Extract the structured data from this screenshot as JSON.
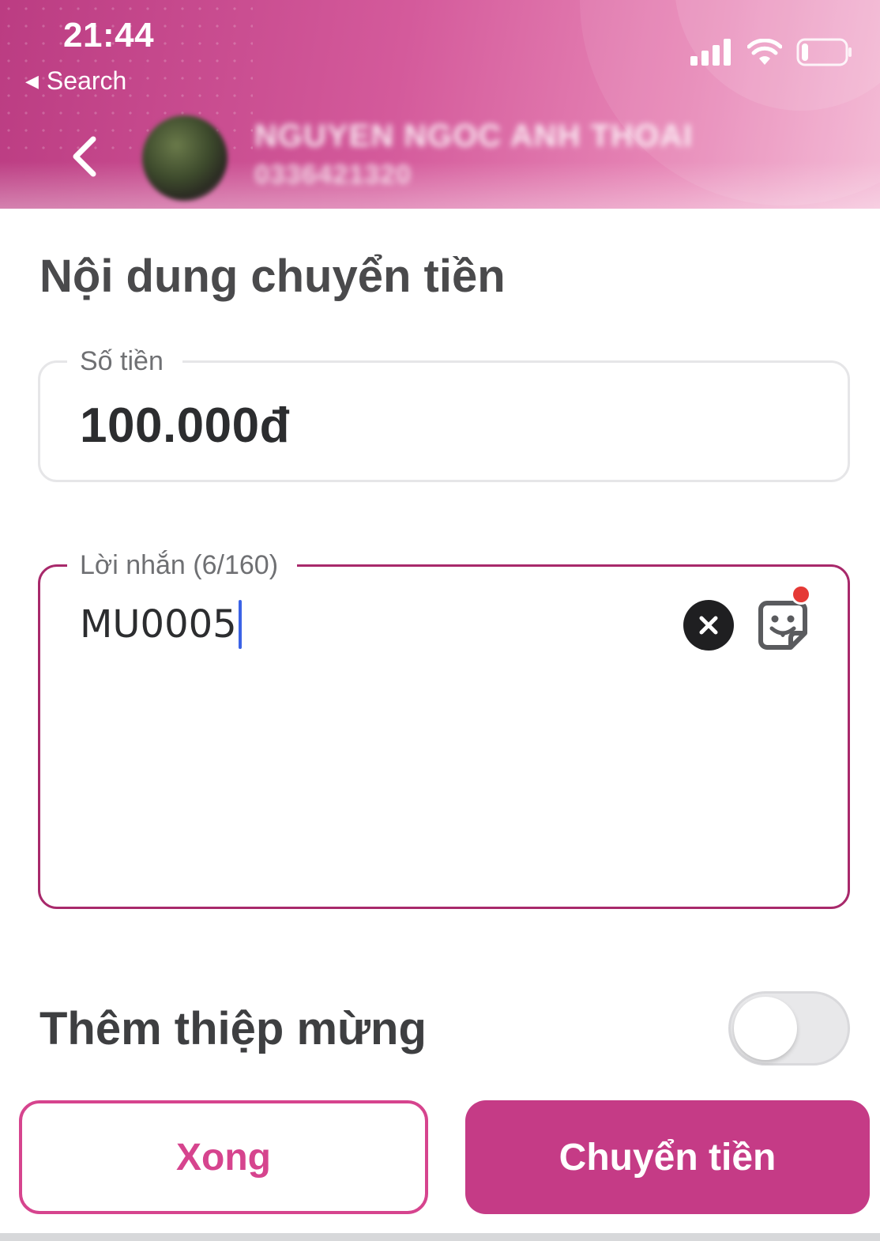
{
  "status_bar": {
    "time": "21:44",
    "back_app_label": "Search",
    "battery_percent": 15
  },
  "header": {
    "recipient_name": "NGUYEN NGOC ANH THOAI",
    "recipient_phone": "0336421320"
  },
  "form": {
    "title": "Nội dung chuyển tiền",
    "amount_label": "Số tiền",
    "amount_value": "100.000đ",
    "message_label": "Lời nhắn (6/160)",
    "message_value": "MU0005"
  },
  "greeting_card": {
    "label": "Thêm thiệp mừng",
    "enabled": false
  },
  "actions": {
    "done_label": "Xong",
    "transfer_label": "Chuyển tiền"
  },
  "colors": {
    "brand": "#c53b86",
    "brand_outline": "#d6448e",
    "focus_border": "#a8296b"
  }
}
